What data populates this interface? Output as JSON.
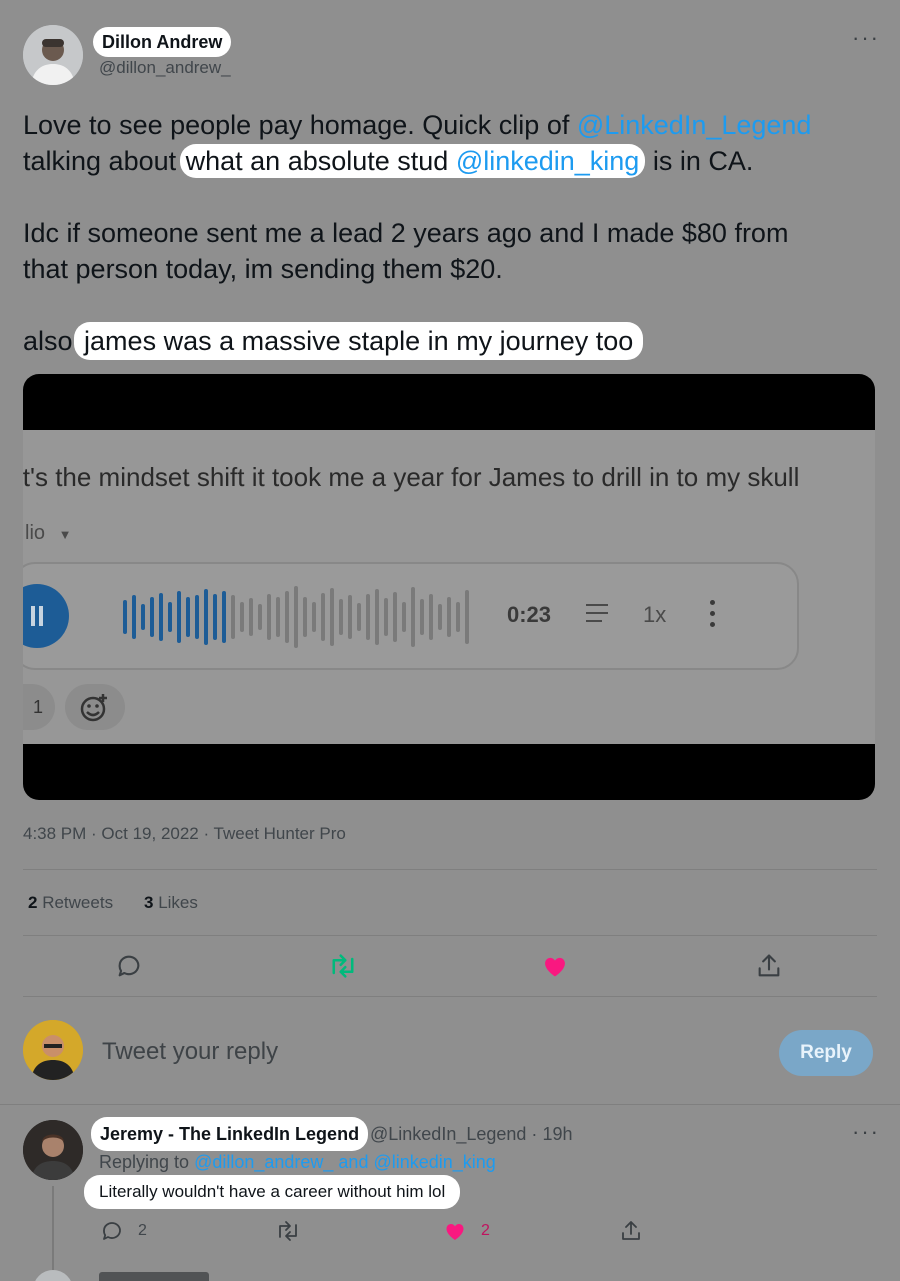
{
  "tweet": {
    "author_name": "Dillon Andrew",
    "author_handle": "@dillon_andrew_",
    "text": {
      "line1_a": "Love to see people pay homage. Quick clip of ",
      "line1_mention": "@LinkedIn_Legend",
      "line2_a": "talking about ",
      "line2_hl_a": "what an absolute stud ",
      "line2_mention": "@linkedin_king",
      "line2_b": " is in CA.",
      "para2_line1": "Idc if someone sent me a lead 2 years ago and I made $80 from",
      "para2_line2": "that person today, im sending them $20.",
      "para3_a": "also ",
      "para3_hl": "james was a massive staple in my journey too"
    },
    "media": {
      "caption": "it's the mindset shift it took me a year for James to drill in to my skull",
      "dropdown_label": "lio",
      "time": "0:23",
      "speed": "1x",
      "reaction_count": "1",
      "progress": 0.3
    },
    "timestamp": "4:38 PM · Oct 19, 2022 · Tweet Hunter Pro",
    "retweets_count": "2",
    "retweets_label": "Retweets",
    "likes_count": "3",
    "likes_label": "Likes"
  },
  "reply_box": {
    "placeholder": "Tweet your reply",
    "button_label": "Reply"
  },
  "reply": {
    "author_name": "Jeremy - The LinkedIn Legend",
    "author_handle": "@LinkedIn_Legend",
    "time": "19h",
    "replying_to_prefix": "Replying to ",
    "replying_to_users": "@dillon_andrew_ and @linkedin_king",
    "text": "Literally wouldn't have a career without him lol",
    "reply_count": "2",
    "like_count": "2"
  },
  "colors": {
    "link": "#1d9bf0",
    "retweet_green": "#00ba7c",
    "like_pink": "#f91880",
    "wave_blue": "#1d5c96",
    "background_overlay": "#8f8f8f"
  }
}
